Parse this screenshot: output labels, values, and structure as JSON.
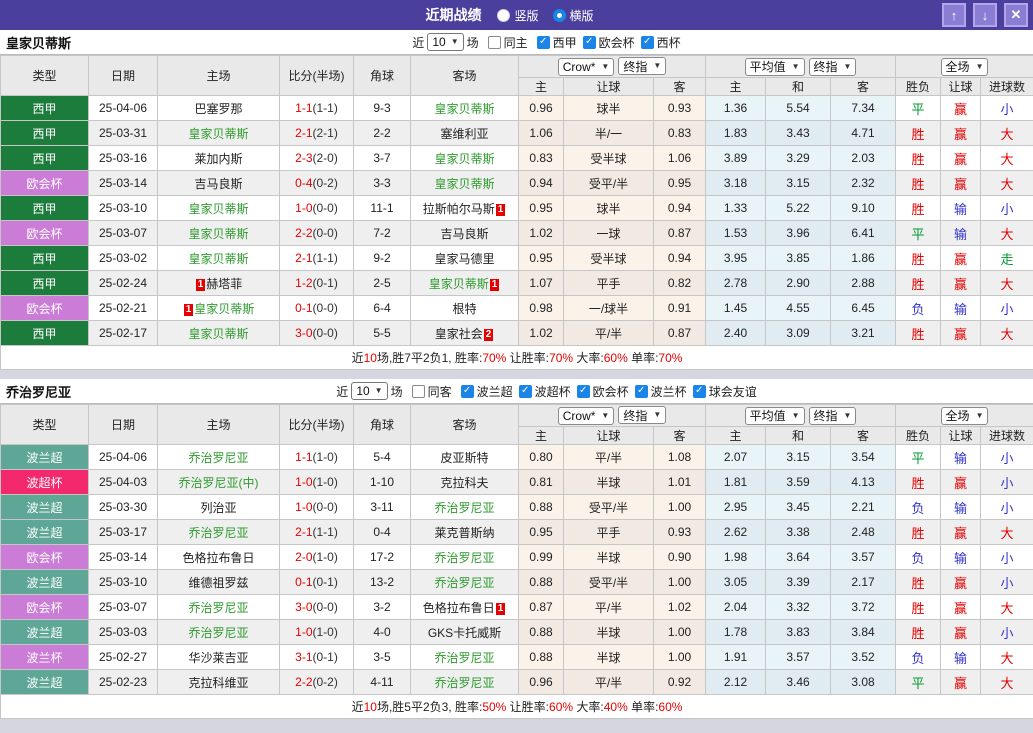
{
  "titlebar": {
    "title": "近期战绩",
    "layout_options": [
      {
        "label": "竖版",
        "selected": false
      },
      {
        "label": "横版",
        "selected": true
      }
    ],
    "window_buttons": [
      {
        "name": "up",
        "glyph": "↑"
      },
      {
        "name": "down",
        "glyph": "↓"
      },
      {
        "name": "close",
        "glyph": "✕"
      }
    ]
  },
  "columns": [
    "类型",
    "日期",
    "主场",
    "比分(半场)",
    "角球",
    "客场",
    "主",
    "让球",
    "客",
    "主",
    "和",
    "客",
    "胜负",
    "让球",
    "进球数"
  ],
  "league_colors": {
    "西甲": "#1c7c3c",
    "欧会杯": "#cb7cd7",
    "波兰超": "#5ea695",
    "波超杯": "#f3286d",
    "波兰杯": "#cb7cd7"
  },
  "result_colors": {
    "胜": "#e60000",
    "平": "#009933",
    "负": "#3333cc",
    "赢": "#e60000",
    "输": "#3333cc",
    "走": "#009933",
    "大": "#e60000",
    "小": "#3333cc"
  },
  "sections": [
    {
      "team": "皇家贝蒂斯",
      "filter": {
        "near": "近",
        "count": "10",
        "suffix": "场",
        "same_label": "同主",
        "same_checked": false,
        "leagues": [
          {
            "label": "西甲",
            "checked": true
          },
          {
            "label": "欧会杯",
            "checked": true
          },
          {
            "label": "西杯",
            "checked": true
          }
        ]
      },
      "dropdowns": {
        "odds_src": "Crow*",
        "odds_period": "终指",
        "avg_src": "平均值",
        "avg_period": "终指",
        "scope": "全场"
      },
      "rows": [
        {
          "league": "西甲",
          "date": "25-04-06",
          "home": {
            "name": "巴塞罗那"
          },
          "ft": "1-1",
          "ht": "(1-1)",
          "corner": "9-3",
          "away": {
            "name": "皇家贝蒂斯",
            "focus": true
          },
          "odds": [
            "0.96",
            "球半",
            "0.93"
          ],
          "avg": [
            "1.36",
            "5.54",
            "7.34"
          ],
          "res": [
            "平",
            "赢",
            "小"
          ]
        },
        {
          "league": "西甲",
          "date": "25-03-31",
          "home": {
            "name": "皇家贝蒂斯",
            "focus": true
          },
          "ft": "2-1",
          "ht": "(2-1)",
          "corner": "2-2",
          "away": {
            "name": "塞维利亚"
          },
          "odds": [
            "1.06",
            "半/一",
            "0.83"
          ],
          "avg": [
            "1.83",
            "3.43",
            "4.71"
          ],
          "res": [
            "胜",
            "赢",
            "大"
          ]
        },
        {
          "league": "西甲",
          "date": "25-03-16",
          "home": {
            "name": "莱加内斯"
          },
          "ft": "2-3",
          "ht": "(2-0)",
          "corner": "3-7",
          "away": {
            "name": "皇家贝蒂斯",
            "focus": true
          },
          "odds": [
            "0.83",
            "受半球",
            "1.06"
          ],
          "avg": [
            "3.89",
            "3.29",
            "2.03"
          ],
          "res": [
            "胜",
            "赢",
            "大"
          ]
        },
        {
          "league": "欧会杯",
          "date": "25-03-14",
          "home": {
            "name": "吉马良斯"
          },
          "ft": "0-4",
          "ht": "(0-2)",
          "corner": "3-3",
          "away": {
            "name": "皇家贝蒂斯",
            "focus": true
          },
          "odds": [
            "0.94",
            "受平/半",
            "0.95"
          ],
          "avg": [
            "3.18",
            "3.15",
            "2.32"
          ],
          "res": [
            "胜",
            "赢",
            "大"
          ]
        },
        {
          "league": "西甲",
          "date": "25-03-10",
          "home": {
            "name": "皇家贝蒂斯",
            "focus": true
          },
          "ft": "1-0",
          "ht": "(0-0)",
          "corner": "11-1",
          "away": {
            "name": "拉斯帕尔马斯",
            "ca": "1"
          },
          "odds": [
            "0.95",
            "球半",
            "0.94"
          ],
          "avg": [
            "1.33",
            "5.22",
            "9.10"
          ],
          "res": [
            "胜",
            "输",
            "小"
          ]
        },
        {
          "league": "欧会杯",
          "date": "25-03-07",
          "home": {
            "name": "皇家贝蒂斯",
            "focus": true
          },
          "ft": "2-2",
          "ht": "(0-0)",
          "corner": "7-2",
          "away": {
            "name": "吉马良斯"
          },
          "odds": [
            "1.02",
            "一球",
            "0.87"
          ],
          "avg": [
            "1.53",
            "3.96",
            "6.41"
          ],
          "res": [
            "平",
            "输",
            "大"
          ]
        },
        {
          "league": "西甲",
          "date": "25-03-02",
          "home": {
            "name": "皇家贝蒂斯",
            "focus": true
          },
          "ft": "2-1",
          "ht": "(1-1)",
          "corner": "9-2",
          "away": {
            "name": "皇家马德里"
          },
          "odds": [
            "0.95",
            "受半球",
            "0.94"
          ],
          "avg": [
            "3.95",
            "3.85",
            "1.86"
          ],
          "res": [
            "胜",
            "赢",
            "走"
          ]
        },
        {
          "league": "西甲",
          "date": "25-02-24",
          "home": {
            "name": "赫塔菲",
            "cb": "1"
          },
          "ft": "1-2",
          "ht": "(0-1)",
          "corner": "2-5",
          "away": {
            "name": "皇家贝蒂斯",
            "focus": true,
            "ca": "1"
          },
          "odds": [
            "1.07",
            "平手",
            "0.82"
          ],
          "avg": [
            "2.78",
            "2.90",
            "2.88"
          ],
          "res": [
            "胜",
            "赢",
            "大"
          ]
        },
        {
          "league": "欧会杯",
          "date": "25-02-21",
          "home": {
            "name": "皇家贝蒂斯",
            "focus": true,
            "cb": "1"
          },
          "ft": "0-1",
          "ht": "(0-0)",
          "corner": "6-4",
          "away": {
            "name": "根特"
          },
          "odds": [
            "0.98",
            "一/球半",
            "0.91"
          ],
          "avg": [
            "1.45",
            "4.55",
            "6.45"
          ],
          "res": [
            "负",
            "输",
            "小"
          ]
        },
        {
          "league": "西甲",
          "date": "25-02-17",
          "home": {
            "name": "皇家贝蒂斯",
            "focus": true
          },
          "ft": "3-0",
          "ht": "(0-0)",
          "corner": "5-5",
          "away": {
            "name": "皇家社会",
            "ca": "2"
          },
          "odds": [
            "1.02",
            "平/半",
            "0.87"
          ],
          "avg": [
            "2.40",
            "3.09",
            "3.21"
          ],
          "res": [
            "胜",
            "赢",
            "大"
          ]
        }
      ],
      "summary": [
        {
          "t": "近",
          "red": false
        },
        {
          "t": "10",
          "red": true
        },
        {
          "t": "场,胜7平2负1, 胜率:",
          "red": false
        },
        {
          "t": "70%",
          "red": true
        },
        {
          "t": " 让胜率:",
          "red": false
        },
        {
          "t": "70%",
          "red": true
        },
        {
          "t": " 大率:",
          "red": false
        },
        {
          "t": "60%",
          "red": true
        },
        {
          "t": " 单率:",
          "red": false
        },
        {
          "t": "70%",
          "red": true
        }
      ]
    },
    {
      "team": "乔治罗尼亚",
      "filter": {
        "near": "近",
        "count": "10",
        "suffix": "场",
        "same_label": "同客",
        "same_checked": false,
        "leagues": [
          {
            "label": "波兰超",
            "checked": true
          },
          {
            "label": "波超杯",
            "checked": true
          },
          {
            "label": "欧会杯",
            "checked": true
          },
          {
            "label": "波兰杯",
            "checked": true
          },
          {
            "label": "球会友谊",
            "checked": true
          }
        ]
      },
      "dropdowns": {
        "odds_src": "Crow*",
        "odds_period": "终指",
        "avg_src": "平均值",
        "avg_period": "终指",
        "scope": "全场"
      },
      "rows": [
        {
          "league": "波兰超",
          "date": "25-04-06",
          "home": {
            "name": "乔治罗尼亚",
            "focus": true
          },
          "ft": "1-1",
          "ht": "(1-0)",
          "corner": "5-4",
          "away": {
            "name": "皮亚斯特"
          },
          "odds": [
            "0.80",
            "平/半",
            "1.08"
          ],
          "avg": [
            "2.07",
            "3.15",
            "3.54"
          ],
          "res": [
            "平",
            "输",
            "小"
          ]
        },
        {
          "league": "波超杯",
          "date": "25-04-03",
          "home": {
            "name": "乔治罗尼亚(中)",
            "focus": true
          },
          "ft": "1-0",
          "ht": "(1-0)",
          "corner": "1-10",
          "away": {
            "name": "克拉科夫"
          },
          "odds": [
            "0.81",
            "半球",
            "1.01"
          ],
          "avg": [
            "1.81",
            "3.59",
            "4.13"
          ],
          "res": [
            "胜",
            "赢",
            "小"
          ]
        },
        {
          "league": "波兰超",
          "date": "25-03-30",
          "home": {
            "name": "列治亚"
          },
          "ft": "1-0",
          "ht": "(0-0)",
          "corner": "3-11",
          "away": {
            "name": "乔治罗尼亚",
            "focus": true
          },
          "odds": [
            "0.88",
            "受平/半",
            "1.00"
          ],
          "avg": [
            "2.95",
            "3.45",
            "2.21"
          ],
          "res": [
            "负",
            "输",
            "小"
          ]
        },
        {
          "league": "波兰超",
          "date": "25-03-17",
          "home": {
            "name": "乔治罗尼亚",
            "focus": true
          },
          "ft": "2-1",
          "ht": "(1-1)",
          "corner": "0-4",
          "away": {
            "name": "莱克普斯纳"
          },
          "odds": [
            "0.95",
            "平手",
            "0.93"
          ],
          "avg": [
            "2.62",
            "3.38",
            "2.48"
          ],
          "res": [
            "胜",
            "赢",
            "大"
          ]
        },
        {
          "league": "欧会杯",
          "date": "25-03-14",
          "home": {
            "name": "色格拉布鲁日"
          },
          "ft": "2-0",
          "ht": "(1-0)",
          "corner": "17-2",
          "away": {
            "name": "乔治罗尼亚",
            "focus": true
          },
          "odds": [
            "0.99",
            "半球",
            "0.90"
          ],
          "avg": [
            "1.98",
            "3.64",
            "3.57"
          ],
          "res": [
            "负",
            "输",
            "小"
          ]
        },
        {
          "league": "波兰超",
          "date": "25-03-10",
          "home": {
            "name": "维德祖罗兹"
          },
          "ft": "0-1",
          "ht": "(0-1)",
          "corner": "13-2",
          "away": {
            "name": "乔治罗尼亚",
            "focus": true
          },
          "odds": [
            "0.88",
            "受平/半",
            "1.00"
          ],
          "avg": [
            "3.05",
            "3.39",
            "2.17"
          ],
          "res": [
            "胜",
            "赢",
            "小"
          ]
        },
        {
          "league": "欧会杯",
          "date": "25-03-07",
          "home": {
            "name": "乔治罗尼亚",
            "focus": true
          },
          "ft": "3-0",
          "ht": "(0-0)",
          "corner": "3-2",
          "away": {
            "name": "色格拉布鲁日",
            "ca": "1"
          },
          "odds": [
            "0.87",
            "平/半",
            "1.02"
          ],
          "avg": [
            "2.04",
            "3.32",
            "3.72"
          ],
          "res": [
            "胜",
            "赢",
            "大"
          ]
        },
        {
          "league": "波兰超",
          "date": "25-03-03",
          "home": {
            "name": "乔治罗尼亚",
            "focus": true
          },
          "ft": "1-0",
          "ht": "(1-0)",
          "corner": "4-0",
          "away": {
            "name": "GKS卡托威斯"
          },
          "odds": [
            "0.88",
            "半球",
            "1.00"
          ],
          "avg": [
            "1.78",
            "3.83",
            "3.84"
          ],
          "res": [
            "胜",
            "赢",
            "小"
          ]
        },
        {
          "league": "波兰杯",
          "date": "25-02-27",
          "home": {
            "name": "华沙莱吉亚"
          },
          "ft": "3-1",
          "ht": "(0-1)",
          "corner": "3-5",
          "away": {
            "name": "乔治罗尼亚",
            "focus": true
          },
          "odds": [
            "0.88",
            "半球",
            "1.00"
          ],
          "avg": [
            "1.91",
            "3.57",
            "3.52"
          ],
          "res": [
            "负",
            "输",
            "大"
          ]
        },
        {
          "league": "波兰超",
          "date": "25-02-23",
          "home": {
            "name": "克拉科维亚"
          },
          "ft": "2-2",
          "ht": "(0-2)",
          "corner": "4-11",
          "away": {
            "name": "乔治罗尼亚",
            "focus": true
          },
          "odds": [
            "0.96",
            "平/半",
            "0.92"
          ],
          "avg": [
            "2.12",
            "3.46",
            "3.08"
          ],
          "res": [
            "平",
            "赢",
            "大"
          ]
        }
      ],
      "summary": [
        {
          "t": "近",
          "red": false
        },
        {
          "t": "10",
          "red": true
        },
        {
          "t": "场,胜5平2负3, 胜率:",
          "red": false
        },
        {
          "t": "50%",
          "red": true
        },
        {
          "t": " 让胜率:",
          "red": false
        },
        {
          "t": "60%",
          "red": true
        },
        {
          "t": " 大率:",
          "red": false
        },
        {
          "t": "40%",
          "red": true
        },
        {
          "t": " 单率:",
          "red": false
        },
        {
          "t": "60%",
          "red": true
        }
      ]
    }
  ]
}
